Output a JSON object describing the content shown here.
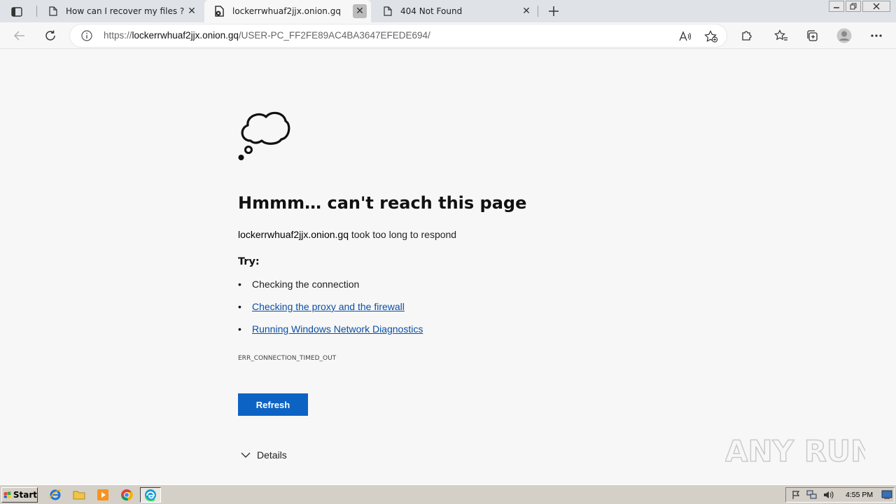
{
  "browser": {
    "tabs": [
      {
        "title": "How can I recover my files ?",
        "active": false
      },
      {
        "title": "lockerrwhuaf2jjx.onion.gq",
        "active": true
      },
      {
        "title": "404 Not Found",
        "active": false
      }
    ],
    "address": {
      "scheme": "https://",
      "host": "lockerrwhuaf2jjx.onion.gq",
      "path": "/USER-PC_FF2FE89AC4BA3647EFEDE694/"
    }
  },
  "error_page": {
    "heading": "Hmmm… can't reach this page",
    "host": "lockerrwhuaf2jjx.onion.gq",
    "message_suffix": " took too long to respond",
    "try_label": "Try:",
    "suggestions": [
      {
        "text": "Checking the connection",
        "is_link": false
      },
      {
        "text": "Checking the proxy and the firewall",
        "is_link": true
      },
      {
        "text": "Running Windows Network Diagnostics",
        "is_link": true
      }
    ],
    "error_code": "ERR_CONNECTION_TIMED_OUT",
    "refresh_label": "Refresh",
    "details_label": "Details"
  },
  "watermark": {
    "text": "ANY RUN"
  },
  "taskbar": {
    "start_label": "Start",
    "clock": "4:55 PM"
  },
  "colors": {
    "accent": "#0c63c4",
    "link": "#0b4fa3"
  }
}
